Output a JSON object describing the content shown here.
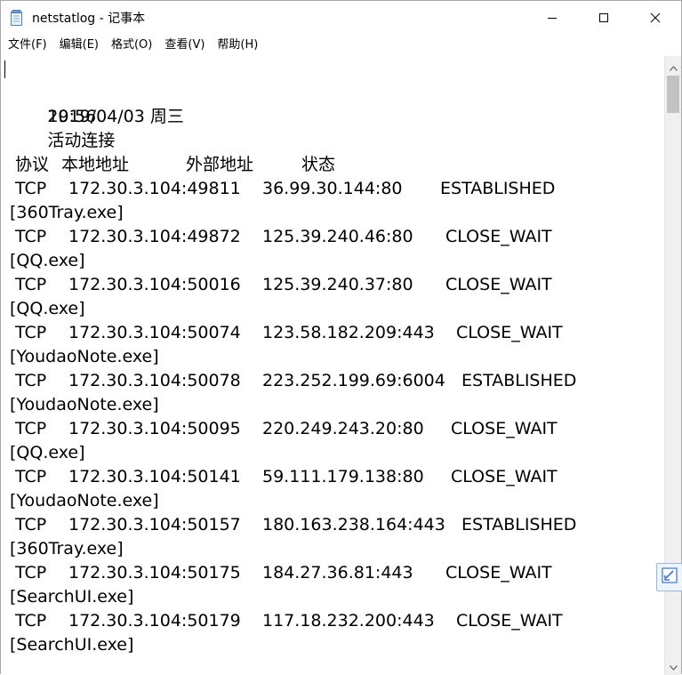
{
  "window": {
    "title": "netstatlog - 记事本"
  },
  "menu": [
    {
      "label": "文件(F)"
    },
    {
      "label": "编辑(E)"
    },
    {
      "label": "格式(O)"
    },
    {
      "label": "查看(V)"
    },
    {
      "label": "帮助(H)"
    }
  ],
  "content": {
    "date": "2019/04/03 周三",
    "time": "19:56",
    "heading": "活动连接",
    "headers": {
      "proto": "协议",
      "local": "本地地址",
      "foreign": "外部地址",
      "state": "状态"
    },
    "connections": [
      {
        "proto": "TCP",
        "local": "172.30.3.104:49811",
        "foreign": "36.99.30.144:80",
        "state": "ESTABLISHED",
        "process": "[360Tray.exe]"
      },
      {
        "proto": "TCP",
        "local": "172.30.3.104:49872",
        "foreign": "125.39.240.46:80",
        "state": "CLOSE_WAIT",
        "process": "[QQ.exe]"
      },
      {
        "proto": "TCP",
        "local": "172.30.3.104:50016",
        "foreign": "125.39.240.37:80",
        "state": "CLOSE_WAIT",
        "process": "[QQ.exe]"
      },
      {
        "proto": "TCP",
        "local": "172.30.3.104:50074",
        "foreign": "123.58.182.209:443",
        "state": "CLOSE_WAIT",
        "process": "[YoudaoNote.exe]"
      },
      {
        "proto": "TCP",
        "local": "172.30.3.104:50078",
        "foreign": "223.252.199.69:6004",
        "state": "ESTABLISHED",
        "process": "[YoudaoNote.exe]"
      },
      {
        "proto": "TCP",
        "local": "172.30.3.104:50095",
        "foreign": "220.249.243.20:80",
        "state": "CLOSE_WAIT",
        "process": "[QQ.exe]"
      },
      {
        "proto": "TCP",
        "local": "172.30.3.104:50141",
        "foreign": "59.111.179.138:80",
        "state": "CLOSE_WAIT",
        "process": "[YoudaoNote.exe]"
      },
      {
        "proto": "TCP",
        "local": "172.30.3.104:50157",
        "foreign": "180.163.238.164:443",
        "state": "ESTABLISHED",
        "process": "[360Tray.exe]"
      },
      {
        "proto": "TCP",
        "local": "172.30.3.104:50175",
        "foreign": "184.27.36.81:443",
        "state": "CLOSE_WAIT",
        "process": "[SearchUI.exe]"
      },
      {
        "proto": "TCP",
        "local": "172.30.3.104:50179",
        "foreign": "117.18.232.200:443",
        "state": "CLOSE_WAIT",
        "process": "[SearchUI.exe]"
      }
    ]
  },
  "icons": {
    "app": "notepad-icon",
    "minimize": "minimize-icon",
    "maximize": "maximize-icon",
    "close": "close-icon",
    "scroll_up": "arrow-up-icon",
    "scroll_down": "arrow-down-icon",
    "side_widget": "screenshot-tool-icon"
  }
}
